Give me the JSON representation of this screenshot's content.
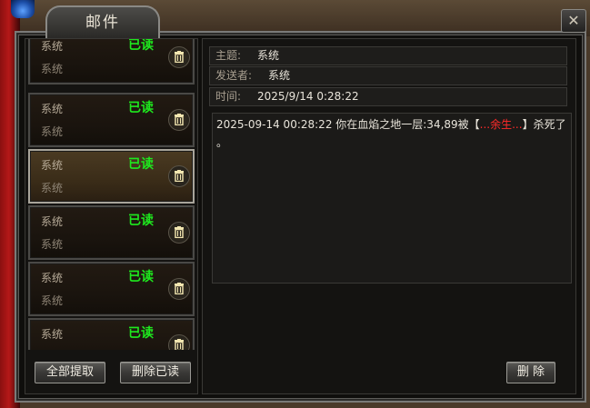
{
  "window": {
    "title": "邮件",
    "close_label": "✕"
  },
  "mail_list": [
    {
      "subject": "系统",
      "sender": "系统",
      "status": "已读"
    },
    {
      "subject": "系统",
      "sender": "系统",
      "status": "已读"
    },
    {
      "subject": "系统",
      "sender": "系统",
      "status": "已读"
    },
    {
      "subject": "系统",
      "sender": "系统",
      "status": "已读"
    },
    {
      "subject": "系统",
      "sender": "系统",
      "status": "已读"
    },
    {
      "subject": "系统",
      "sender": "系统",
      "status": "已读"
    }
  ],
  "left_buttons": {
    "claim_all": "全部提取",
    "delete_read": "删除已读"
  },
  "detail": {
    "subject_label": "主题:",
    "subject_value": "系统",
    "sender_label": "发送者:",
    "sender_value": "系统",
    "time_label": "时间:",
    "time_value": "2025/9/14 0:28:22",
    "body_prefix": "2025-09-14 00:28:22   你在血焰之地一层:34,89被【",
    "body_killer": "...余生...",
    "body_suffix": "】杀死了",
    "body_end": "。",
    "delete_label": "删 除"
  },
  "colors": {
    "status_read": "#1ee81e",
    "killer_name": "#ff2a2a"
  },
  "icons": {
    "trash": "trash-icon",
    "close": "close-icon"
  }
}
